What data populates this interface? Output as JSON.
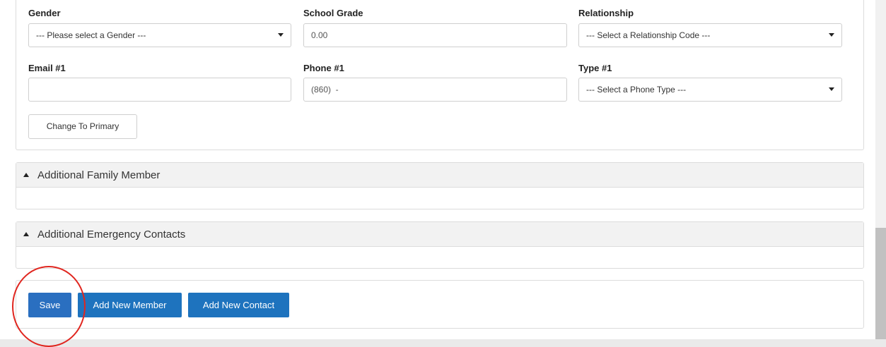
{
  "form": {
    "gender": {
      "label": "Gender",
      "value": "--- Please select a Gender ---"
    },
    "school_grade": {
      "label": "School Grade",
      "value": "0.00"
    },
    "relationship": {
      "label": "Relationship",
      "value": "--- Select a Relationship Code ---"
    },
    "email1": {
      "label": "Email #1",
      "value": ""
    },
    "phone1": {
      "label": "Phone #1",
      "value": "(860)  -"
    },
    "type1": {
      "label": "Type #1",
      "value": "--- Select a Phone Type ---"
    },
    "change_primary_label": "Change To Primary"
  },
  "panels": {
    "family": {
      "title": "Additional Family Member"
    },
    "emergency": {
      "title": "Additional Emergency Contacts"
    }
  },
  "actions": {
    "save": "Save",
    "add_member": "Add New Member",
    "add_contact": "Add New Contact"
  },
  "colors": {
    "primary_button": "#1e73be",
    "annotation": "#e0261f"
  }
}
